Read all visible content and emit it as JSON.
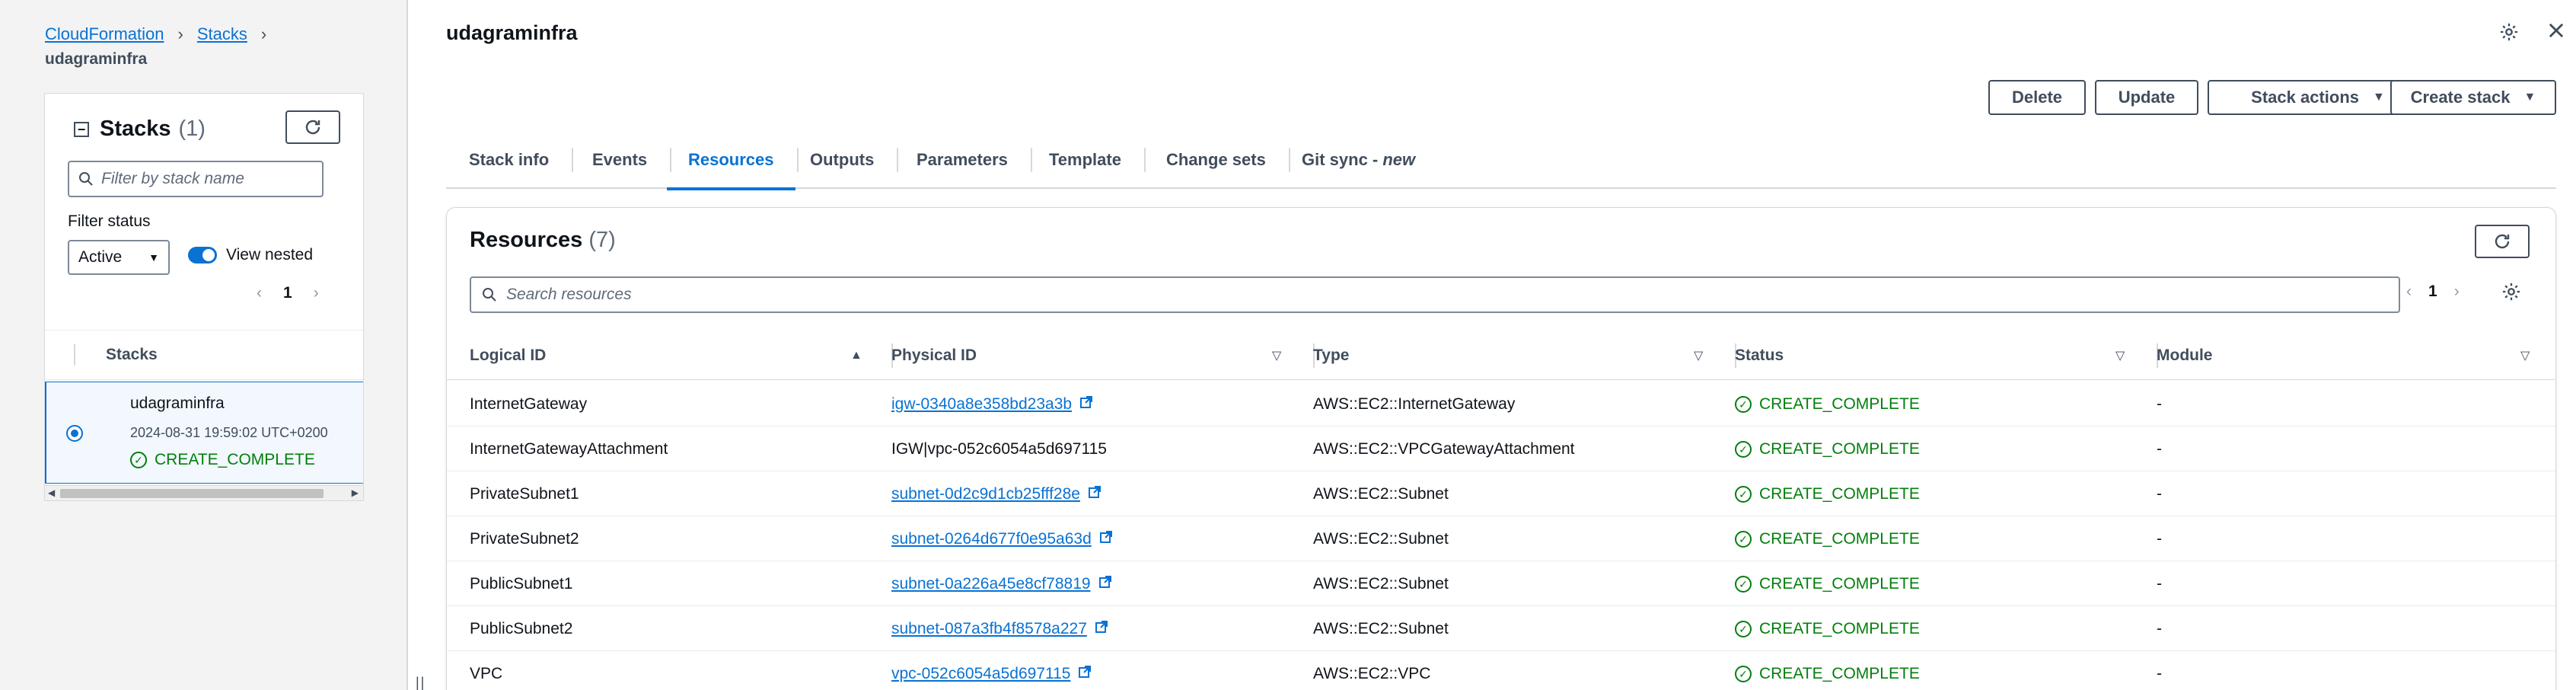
{
  "breadcrumb": {
    "items": [
      "CloudFormation",
      "Stacks"
    ],
    "current": "udagraminfra"
  },
  "stacks_panel": {
    "title": "Stacks",
    "count": "(1)",
    "filter_placeholder": "Filter by stack name",
    "filter_status_label": "Filter status",
    "filter_status_value": "Active",
    "view_nested_label": "View nested",
    "page": "1",
    "column_header": "Stacks",
    "stack": {
      "name": "udagraminfra",
      "time": "2024-08-31 19:59:02 UTC+0200",
      "status": "CREATE_COMPLETE"
    }
  },
  "page_title": "udagraminfra",
  "actions": {
    "delete": "Delete",
    "update": "Update",
    "stack_actions": "Stack actions",
    "create_stack": "Create stack"
  },
  "tabs": [
    {
      "label": "Stack info"
    },
    {
      "label": "Events"
    },
    {
      "label": "Resources"
    },
    {
      "label": "Outputs"
    },
    {
      "label": "Parameters"
    },
    {
      "label": "Template"
    },
    {
      "label": "Change sets"
    },
    {
      "label": "Git sync - ",
      "suffix": "new"
    }
  ],
  "active_tab": "Resources",
  "resources": {
    "title": "Resources",
    "count": "(7)",
    "search_placeholder": "Search resources",
    "page": "1",
    "columns": [
      "Logical ID",
      "Physical ID",
      "Type",
      "Status",
      "Module"
    ],
    "rows": [
      {
        "logical_id": "InternetGateway",
        "physical_id": "igw-0340a8e358bd23a3b",
        "link": true,
        "type": "AWS::EC2::InternetGateway",
        "status": "CREATE_COMPLETE",
        "module": "-"
      },
      {
        "logical_id": "InternetGatewayAttachment",
        "physical_id": "IGW|vpc-052c6054a5d697115",
        "link": false,
        "type": "AWS::EC2::VPCGatewayAttachment",
        "status": "CREATE_COMPLETE",
        "module": "-"
      },
      {
        "logical_id": "PrivateSubnet1",
        "physical_id": "subnet-0d2c9d1cb25fff28e",
        "link": true,
        "type": "AWS::EC2::Subnet",
        "status": "CREATE_COMPLETE",
        "module": "-"
      },
      {
        "logical_id": "PrivateSubnet2",
        "physical_id": "subnet-0264d677f0e95a63d",
        "link": true,
        "type": "AWS::EC2::Subnet",
        "status": "CREATE_COMPLETE",
        "module": "-"
      },
      {
        "logical_id": "PublicSubnet1",
        "physical_id": "subnet-0a226a45e8cf78819",
        "link": true,
        "type": "AWS::EC2::Subnet",
        "status": "CREATE_COMPLETE",
        "module": "-"
      },
      {
        "logical_id": "PublicSubnet2",
        "physical_id": "subnet-087a3fb4f8578a227",
        "link": true,
        "type": "AWS::EC2::Subnet",
        "status": "CREATE_COMPLETE",
        "module": "-"
      },
      {
        "logical_id": "VPC",
        "physical_id": "vpc-052c6054a5d697115",
        "link": true,
        "type": "AWS::EC2::VPC",
        "status": "CREATE_COMPLETE",
        "module": "-"
      }
    ]
  },
  "colors": {
    "link": "#0972d3",
    "success": "#037f0c",
    "text": "#0f141a",
    "muted": "#414d5c",
    "panel_bg": "#f3f3f4"
  }
}
